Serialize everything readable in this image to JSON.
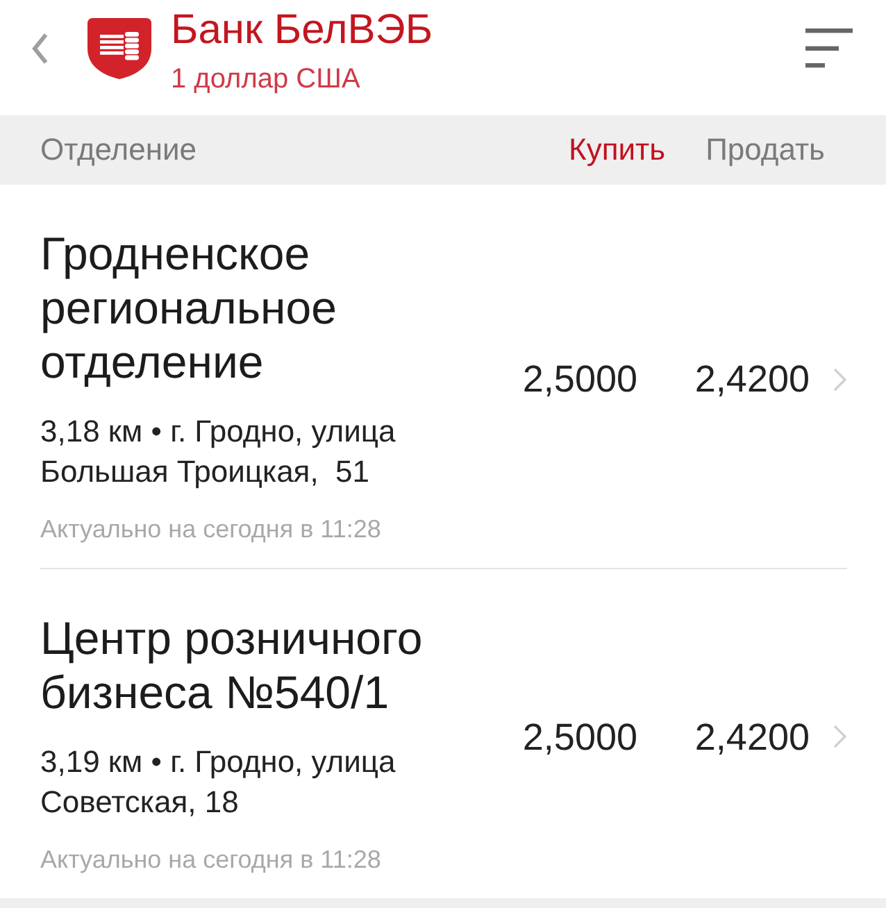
{
  "header": {
    "title": "Банк БелВЭБ",
    "subtitle": "1 доллар США"
  },
  "columns": [
    {
      "label": "Отделение",
      "selected": false
    },
    {
      "label": "Купить",
      "selected": true
    },
    {
      "label": "Продать",
      "selected": false
    }
  ],
  "branches": [
    {
      "name": "Гродненское региональное отделение",
      "address": "3,18 км • г. Гродно, улица Большая Троицкая,  51",
      "updated": "Актуально на сегодня в 11:28",
      "buy": "2,5000",
      "sell": "2,4200"
    },
    {
      "name": "Центр розничного бизнеса №540/1",
      "address": "3,19 км • г. Гродно, улица Советская, 18",
      "updated": "Актуально на сегодня в 11:28",
      "buy": "2,5000",
      "sell": "2,4200"
    }
  ]
}
